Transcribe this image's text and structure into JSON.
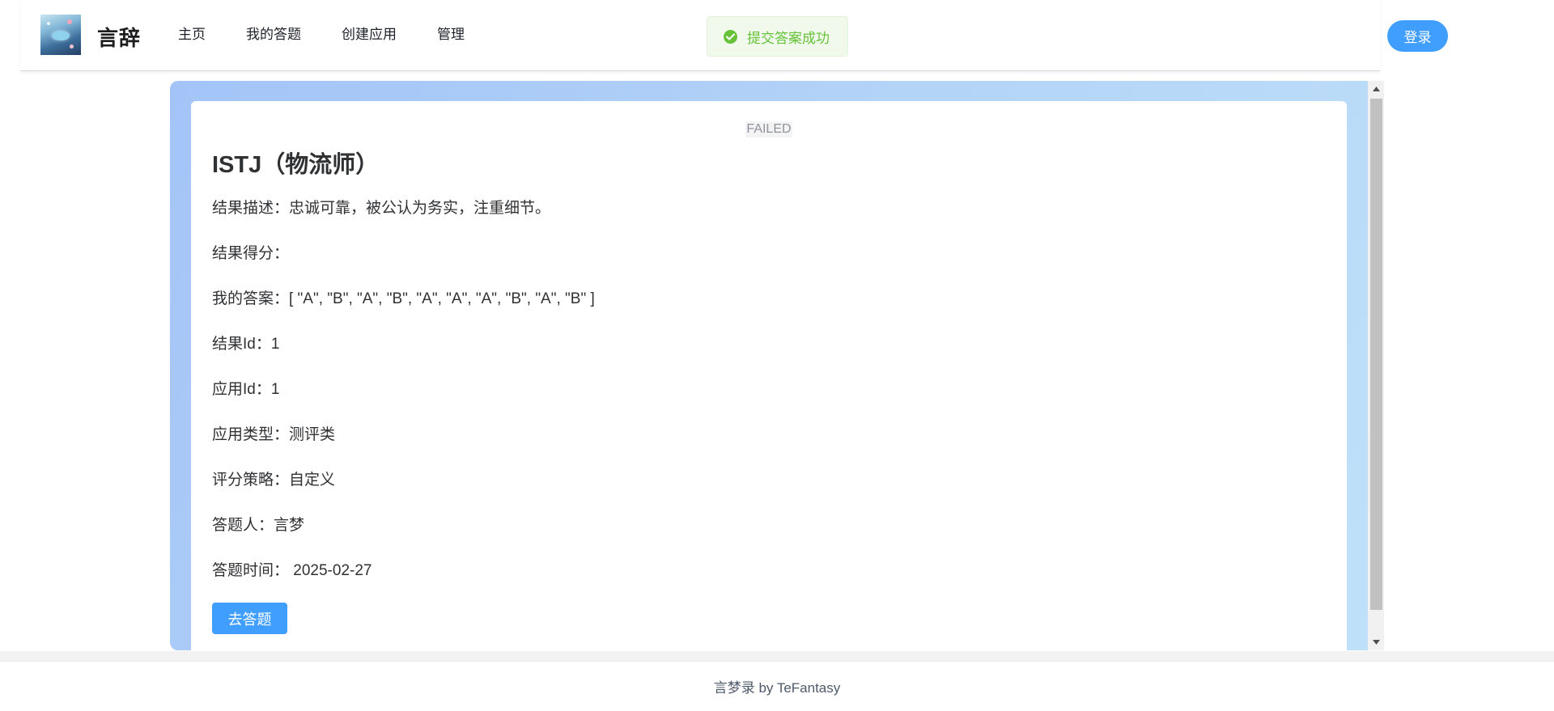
{
  "header": {
    "brand": "言辞",
    "nav": [
      {
        "label": "主页"
      },
      {
        "label": "我的答题"
      },
      {
        "label": "创建应用"
      },
      {
        "label": "管理"
      }
    ],
    "login_label": "登录"
  },
  "toast": {
    "message": "提交答案成功",
    "type": "success",
    "color": "#67c23a"
  },
  "result": {
    "status": "FAILED",
    "title": "ISTJ（物流师）",
    "fields": {
      "description": "结果描述：忠诚可靠，被公认为务实，注重细节。",
      "score": "结果得分：",
      "answers": "我的答案：[ \"A\", \"B\", \"A\", \"B\", \"A\", \"A\", \"A\", \"B\", \"A\", \"B\" ]",
      "result_id": "结果Id：1",
      "app_id": "应用Id：1",
      "app_type": "应用类型：测评类",
      "strategy": "评分策略：自定义",
      "user": "答题人：言梦",
      "time": "答题时间： 2025-02-27"
    },
    "action_label": "去答题"
  },
  "footer": {
    "text": "言梦录 by TeFantasy"
  },
  "colors": {
    "primary": "#409eff",
    "success": "#67c23a",
    "tag_bg": "#f4f4f5",
    "tag_text": "#909399"
  }
}
